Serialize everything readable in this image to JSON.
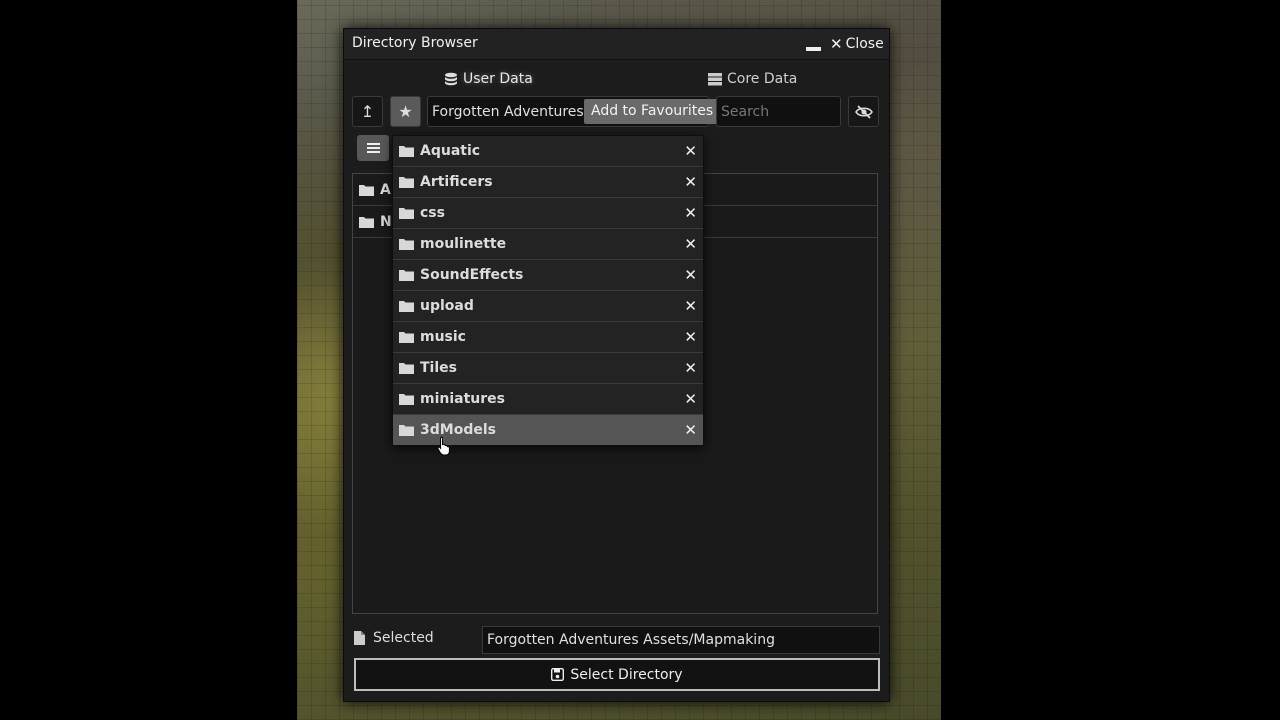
{
  "window": {
    "title": "Directory Browser",
    "close_label": "Close"
  },
  "tabs": [
    {
      "label": "User Data",
      "icon": "database-icon",
      "active": true
    },
    {
      "label": "Core Data",
      "icon": "server-icon",
      "active": false
    }
  ],
  "toolbar": {
    "path_value": "Forgotten Adventures Assets/Mapmaking",
    "add_favourite_label": "Add to Favourites",
    "search_placeholder": "Search"
  },
  "list_rows": [
    {
      "label": "Ar"
    },
    {
      "label": "Na"
    }
  ],
  "favourites": [
    {
      "label": "Aquatic"
    },
    {
      "label": "Artificers"
    },
    {
      "label": "css"
    },
    {
      "label": "moulinette"
    },
    {
      "label": "SoundEffects"
    },
    {
      "label": "upload"
    },
    {
      "label": "music"
    },
    {
      "label": "Tiles"
    },
    {
      "label": "miniatures"
    },
    {
      "label": "3dModels"
    }
  ],
  "footer": {
    "selected_label": "Selected",
    "selected_value": "Forgotten Adventures Assets/Mapmaking",
    "select_button_label": "Select Directory"
  },
  "colors": {
    "dialog_bg": "#1c1c1c",
    "hover_row": "#555555",
    "button_border": "#bdbdbd"
  }
}
